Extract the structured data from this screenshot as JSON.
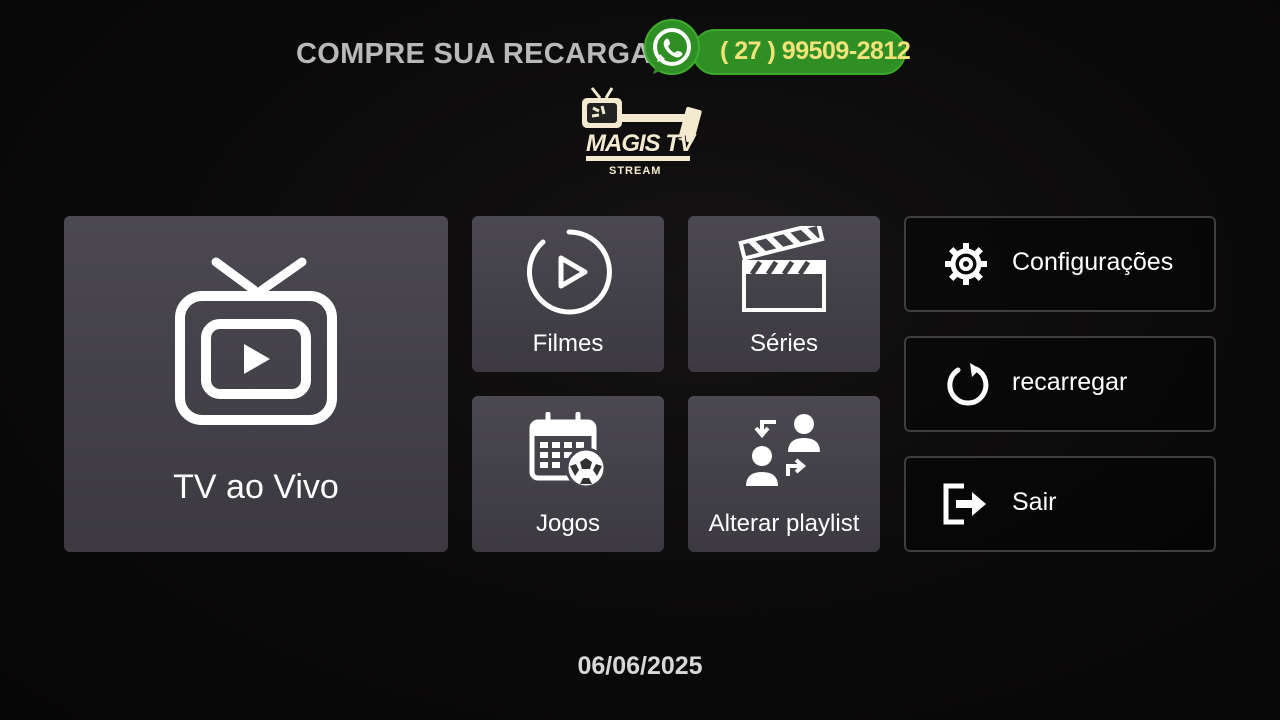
{
  "promo": {
    "text": "COMPRE SUA RECARGA",
    "phone": "( 27 ) 99509-2812",
    "whatsapp_icon": "whatsapp-icon"
  },
  "logo": {
    "title": "MAGIS TV",
    "subtitle": "STREAM"
  },
  "tiles": {
    "live": {
      "label": "TV ao Vivo",
      "icon": "tv-play-icon"
    },
    "movies": {
      "label": "Filmes",
      "icon": "play-circle-icon"
    },
    "series": {
      "label": "Séries",
      "icon": "clapperboard-icon"
    },
    "games": {
      "label": "Jogos",
      "icon": "calendar-football-icon"
    },
    "playlist": {
      "label": "Alterar playlist",
      "icon": "switch-users-icon"
    }
  },
  "side_buttons": [
    {
      "label": "Configurações",
      "icon": "gear-icon"
    },
    {
      "label": "recarregar",
      "icon": "refresh-icon"
    },
    {
      "label": "Sair",
      "icon": "exit-icon"
    }
  ],
  "footer": {
    "date": "06/06/2025"
  },
  "colors": {
    "tile_bg": "#45434a",
    "whatsapp_green": "#2f8f24",
    "phone_text": "#f2e27a",
    "logo_cream": "#f3ead0"
  }
}
